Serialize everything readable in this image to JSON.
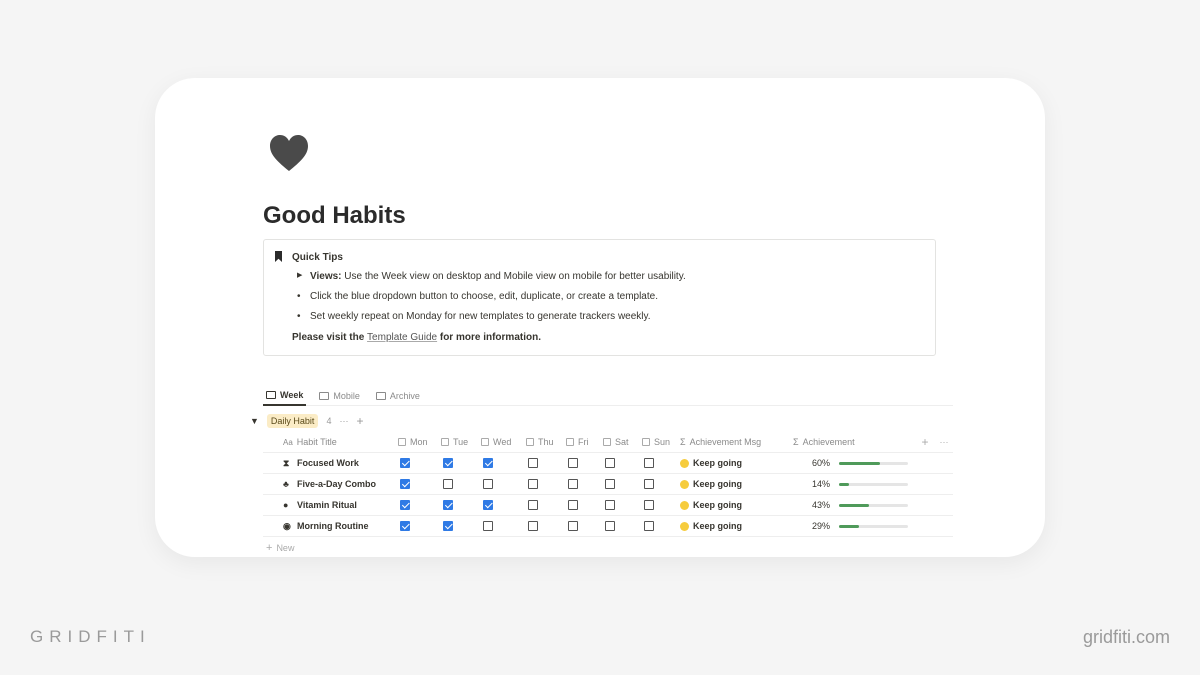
{
  "page": {
    "title": "Good Habits",
    "icon": "heart-icon"
  },
  "callout": {
    "title": "Quick Tips",
    "items": [
      {
        "marker": "▶",
        "bold": "Views:",
        "text": " Use the Week view on desktop and Mobile view on mobile for better usability."
      },
      {
        "marker": "•",
        "bold": "",
        "text": "Click the blue dropdown button to choose, edit, duplicate, or create a template."
      },
      {
        "marker": "•",
        "bold": "",
        "text": "Set weekly repeat on Monday for new templates to generate trackers weekly."
      }
    ],
    "foot_pre": "Please visit the ",
    "foot_link": "Template Guide",
    "foot_post": " for more information."
  },
  "tabs": [
    {
      "label": "Week",
      "active": true
    },
    {
      "label": "Mobile"
    },
    {
      "label": "Archive"
    }
  ],
  "group": {
    "label": "Daily Habit",
    "count": "4"
  },
  "columns": [
    "Habit Title",
    "Mon",
    "Tue",
    "Wed",
    "Thu",
    "Fri",
    "Sat",
    "Sun",
    "Achievement Msg",
    "Achievement"
  ],
  "rows": [
    {
      "icon": "hourglass-icon",
      "glyph": "⧗",
      "title": "Focused Work",
      "days": [
        true,
        true,
        true,
        false,
        false,
        false,
        false
      ],
      "msg": "Keep going",
      "pct": "60%",
      "value": 60
    },
    {
      "icon": "cherries-icon",
      "glyph": "♣",
      "title": "Five-a-Day Combo",
      "days": [
        true,
        false,
        false,
        false,
        false,
        false,
        false
      ],
      "msg": "Keep going",
      "pct": "14%",
      "value": 14
    },
    {
      "icon": "drop-icon",
      "glyph": "●",
      "title": "Vitamin Ritual",
      "days": [
        true,
        true,
        true,
        false,
        false,
        false,
        false
      ],
      "msg": "Keep going",
      "pct": "43%",
      "value": 43
    },
    {
      "icon": "target-icon",
      "glyph": "◉",
      "title": "Morning Routine",
      "days": [
        true,
        true,
        false,
        false,
        false,
        false,
        false
      ],
      "msg": "Keep going",
      "pct": "29%",
      "value": 29
    }
  ],
  "new_label": "New",
  "colors": {
    "checkbox": "#2f7ae5",
    "progress": "#4f9a5a",
    "pill": "#fbecc6"
  },
  "brand": {
    "left": "GRIDFITI",
    "right": "gridfiti.com"
  }
}
